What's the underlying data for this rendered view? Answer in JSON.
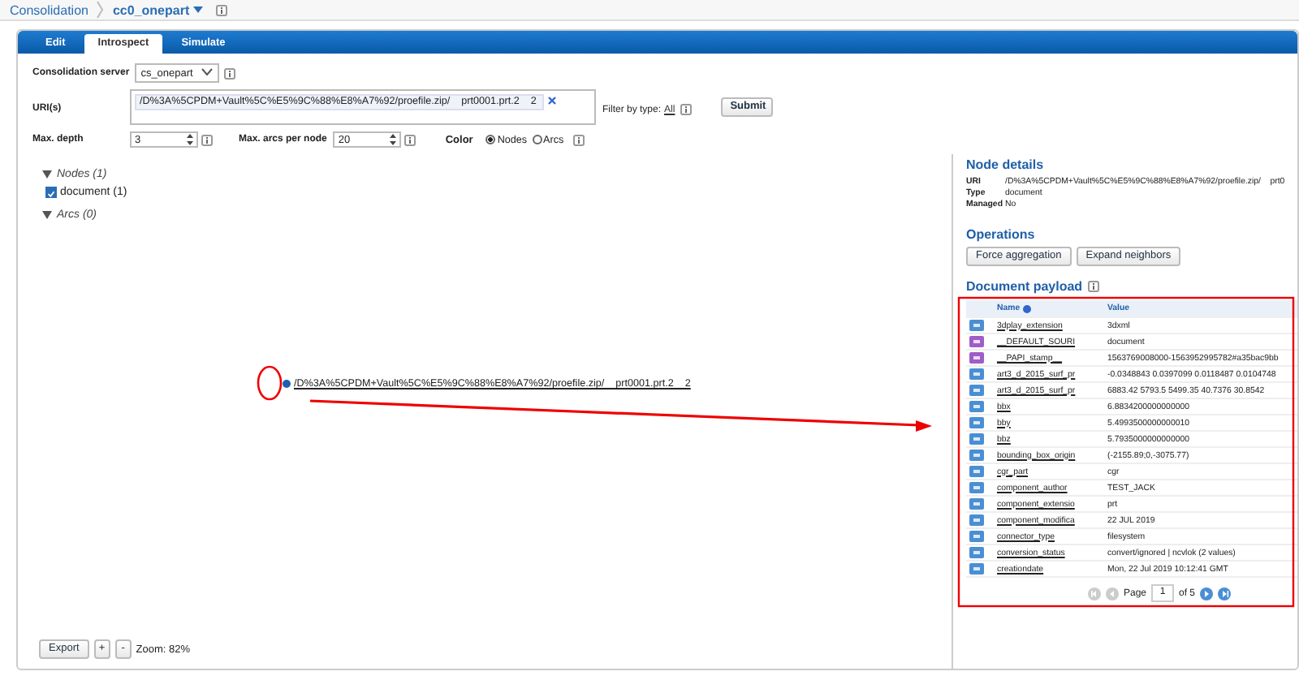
{
  "breadcrumb": {
    "root": "Consolidation",
    "current": "cc0_onepart"
  },
  "tabs": [
    {
      "label": "Edit",
      "selected": false
    },
    {
      "label": "Introspect",
      "selected": true
    },
    {
      "label": "Simulate",
      "selected": false
    }
  ],
  "form": {
    "server_label": "Consolidation server",
    "server_value": "cs_onepart",
    "uri_label": "URI(s)",
    "uri_token": "/D%3A%5CPDM+Vault%5C%E5%9C%88%E8%A7%92/proefile.zip/    prt0001.prt.2    2",
    "filter_label": "Filter by type:",
    "filter_value": "All",
    "submit": "Submit",
    "depth_label": "Max. depth",
    "depth_value": "3",
    "arcs_label": "Max. arcs per node",
    "arcs_value": "20",
    "color_label": "Color",
    "color_options": [
      {
        "label": "Nodes",
        "selected": true
      },
      {
        "label": "Arcs",
        "selected": false
      }
    ]
  },
  "tree": [
    {
      "label": "Nodes (1)",
      "expanded": true,
      "children": [
        {
          "label": "document (1)",
          "checked": true
        }
      ]
    },
    {
      "label": "Arcs (0)",
      "expanded": true
    }
  ],
  "graph": {
    "node_label": "/D%3A%5CPDM+Vault%5C%E5%9C%88%E8%A7%92/proefile.zip/    prt0001.prt.2    2"
  },
  "toolbar": {
    "export": "Export",
    "zoom_in": "+",
    "zoom_out": "-",
    "zoom": "Zoom: 82%"
  },
  "details": {
    "title": "Node details",
    "fields": [
      {
        "label": "URI",
        "value": "/D%3A%5CPDM+Vault%5C%E5%9C%88%E8%A7%92/proefile.zip/    prt0"
      },
      {
        "label": "Type",
        "value": "document"
      },
      {
        "label": "Managed",
        "value": "No"
      }
    ],
    "operations_title": "Operations",
    "operations": [
      "Force aggregation",
      "Expand neighbors"
    ],
    "payload_title": "Document payload",
    "columns": [
      "Name",
      "Value"
    ],
    "rows": [
      {
        "kind": "property",
        "name": "3dplay_extension",
        "value": "3dxml"
      },
      {
        "kind": "system",
        "name": "__DEFAULT_SOURI",
        "value": "document"
      },
      {
        "kind": "system",
        "name": "__PAPI_stamp__",
        "value": "1563769008000-1563952995782#a35bac9bb"
      },
      {
        "kind": "property",
        "name": "art3_d_2015_surf_pr",
        "value": "-0.0348843 0.0397099 0.0118487 0.0104748"
      },
      {
        "kind": "property",
        "name": "art3_d_2015_surf_pr",
        "value": "6883.42 5793.5 5499.35 40.7376 30.8542"
      },
      {
        "kind": "property",
        "name": "bbx",
        "value": "6.8834200000000000"
      },
      {
        "kind": "property",
        "name": "bby",
        "value": "5.4993500000000010"
      },
      {
        "kind": "property",
        "name": "bbz",
        "value": "5.7935000000000000"
      },
      {
        "kind": "property",
        "name": "bounding_box_origin",
        "value": "(-2155.89;0,-3075.77)"
      },
      {
        "kind": "property",
        "name": "cgr_part",
        "value": "cgr"
      },
      {
        "kind": "property",
        "name": "component_author",
        "value": "TEST_JACK"
      },
      {
        "kind": "property",
        "name": "component_extensio",
        "value": "prt"
      },
      {
        "kind": "property",
        "name": "component_modifica",
        "value": "22 JUL 2019"
      },
      {
        "kind": "property",
        "name": "connector_type",
        "value": "filesystem"
      },
      {
        "kind": "property",
        "name": "conversion_status",
        "value": "convert/ignored | ncvlok (2 values)"
      },
      {
        "kind": "property",
        "name": "creationdate",
        "value": "Mon, 22 Jul 2019 10:12:41 GMT"
      }
    ],
    "pager": {
      "page_label": "Page",
      "page": "1",
      "of": "of 5"
    }
  }
}
